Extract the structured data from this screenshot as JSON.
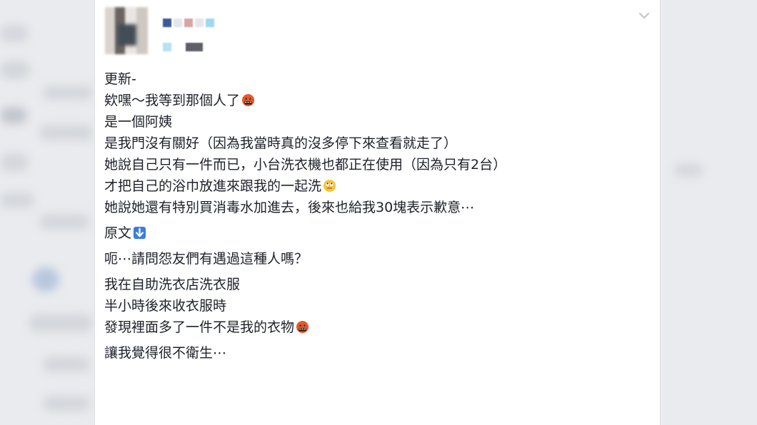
{
  "post": {
    "author_avatar": "avatar-blurred",
    "menu_icon": "chevron-down-icon",
    "lines_update": [
      "更新-",
      "欸嘿～我等到那個人了",
      "是一個阿姨",
      "是我門沒有關好（因為我當時真的沒多停下來查看就走了）",
      "她說自己只有一件而已，小台洗衣機也都正在使用（因為只有2台）",
      "才把自己的浴巾放進來跟我的一起洗",
      "她說她還有特別買消毒水加進去，後來也給我30塊表示歉意⋯"
    ],
    "original_label": "原文",
    "question": "呃⋯請問怨友們有遇過這種人嗎？",
    "lines_story": [
      "我在自助洗衣店洗衣服",
      "半小時後來收衣服時",
      "發現裡面多了一件不是我的衣物"
    ],
    "closing": "讓我覺得很不衛生⋯",
    "emojis": {
      "angry": "face-with-symbols-on-mouth-emoji",
      "eye_roll": "face-with-rolling-eyes-emoji",
      "down_arrow": "down-arrow-emoji"
    }
  },
  "colors": {
    "text": "#1d2129",
    "background": "#e9ebee",
    "card": "#ffffff",
    "emoji_angry": "#e8582a",
    "emoji_eyes": "#f7c33b",
    "emoji_arrow": "#3b7ddd"
  }
}
